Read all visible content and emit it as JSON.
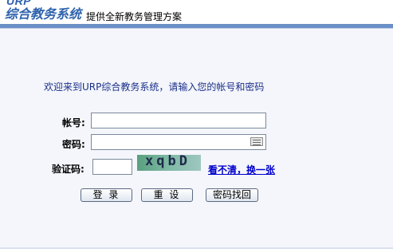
{
  "header": {
    "logo_small": "URP",
    "logo_main": "综合教务系统",
    "tagline": "提供全新教务管理方案"
  },
  "login": {
    "welcome": "欢迎来到URP综合教务系统，请输入您的帐号和密码",
    "account_label": "帐号:",
    "password_label": "密码:",
    "captcha_label": "验证码:",
    "account_value": "",
    "password_value": "",
    "captcha_value": "",
    "captcha_text": "xqbD",
    "refresh_captcha": "看不清，换一张"
  },
  "buttons": {
    "login": "登 录",
    "reset": "重 设",
    "recover": "密码找回"
  },
  "icons": {
    "keyboard": "keyboard-icon"
  }
}
